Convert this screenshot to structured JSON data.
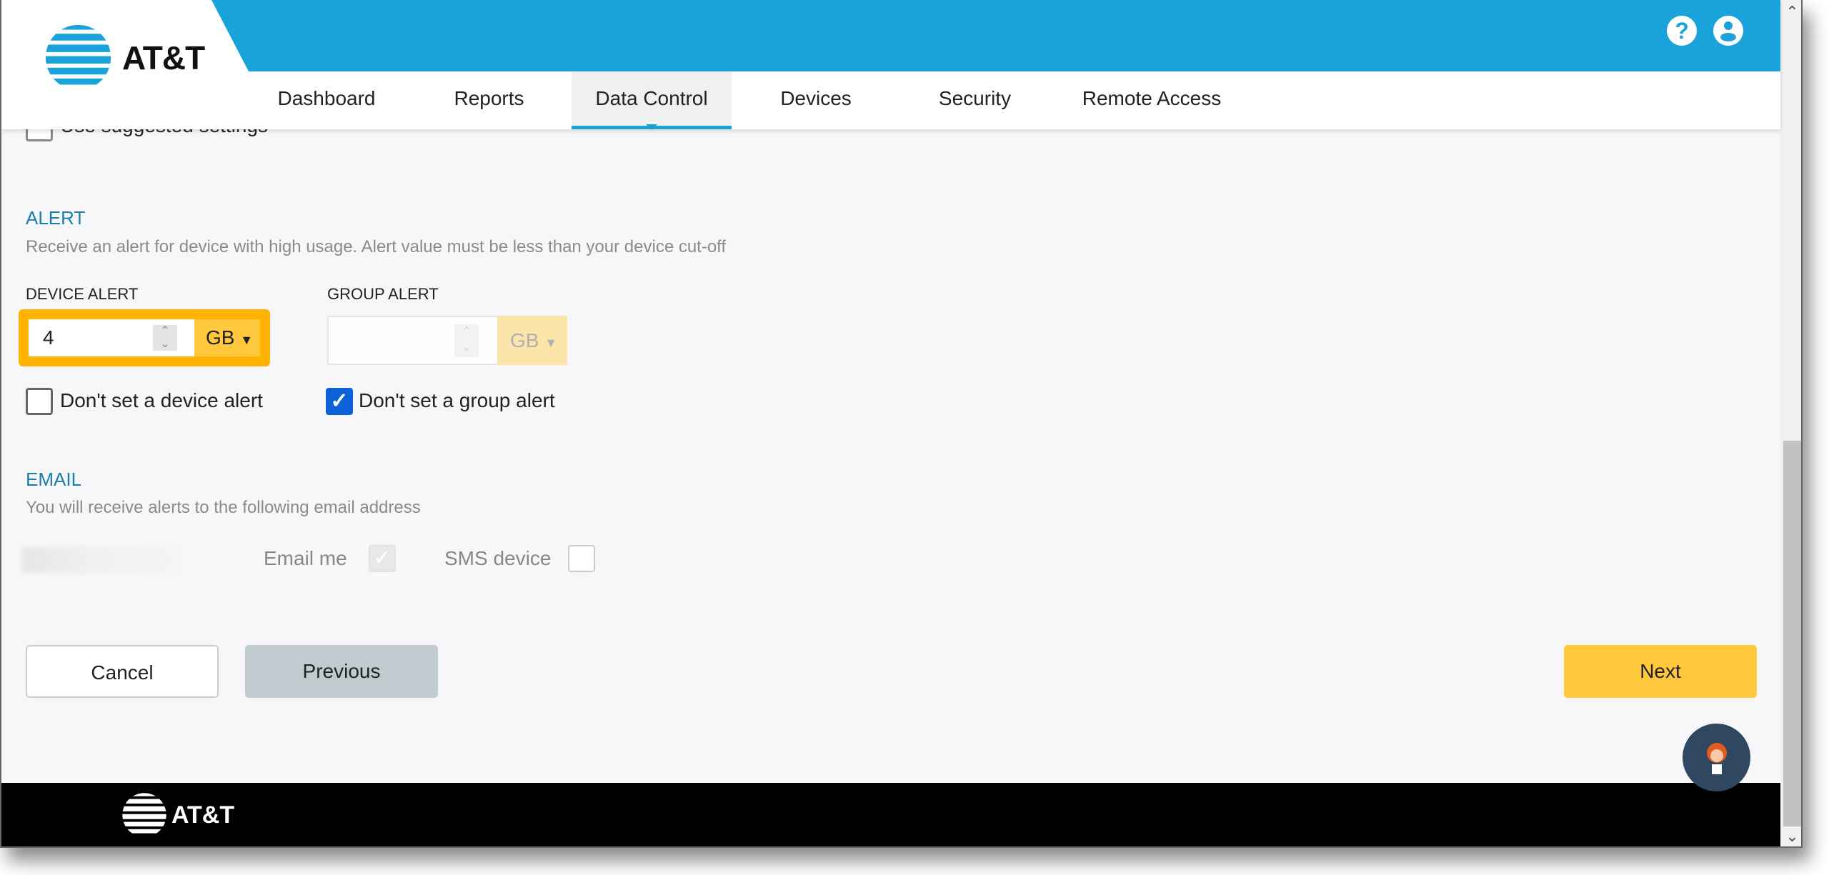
{
  "brand": {
    "name": "AT&T",
    "accent": "#1aa3db",
    "cta": "#ffc83d"
  },
  "nav": {
    "tabs": [
      {
        "label": "Dashboard"
      },
      {
        "label": "Reports"
      },
      {
        "label": "Data Control",
        "active": true
      },
      {
        "label": "Devices"
      },
      {
        "label": "Security"
      },
      {
        "label": "Remote Access"
      }
    ]
  },
  "header_icons": {
    "help": "?",
    "account": "user-icon"
  },
  "suggested": {
    "label": "Use suggested settings",
    "checked": false
  },
  "alert": {
    "title": "ALERT",
    "description": "Receive an alert for device with high usage. Alert value must be less than your device cut-off",
    "device": {
      "label": "DEVICE ALERT",
      "value": "4",
      "unit": "GB",
      "no_alert_label": "Don't set a device alert",
      "no_alert_checked": false
    },
    "group": {
      "label": "GROUP ALERT",
      "value": "",
      "unit": "GB",
      "no_alert_label": "Don't set a group alert",
      "no_alert_checked": true
    }
  },
  "email": {
    "title": "EMAIL",
    "description": "You will receive alerts to the following email address",
    "email_me_label": "Email me",
    "email_me_checked": true,
    "sms_label": "SMS device",
    "sms_checked": false
  },
  "buttons": {
    "cancel": "Cancel",
    "previous": "Previous",
    "next": "Next"
  },
  "footer": {
    "logo": "AT&T"
  }
}
